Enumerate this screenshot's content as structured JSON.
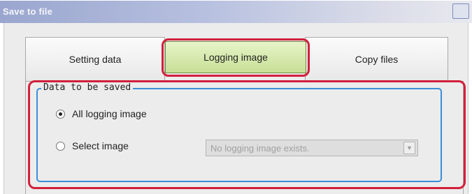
{
  "window": {
    "title": "Save to file"
  },
  "tabs": [
    {
      "label": "Setting data"
    },
    {
      "label": "Logging image"
    },
    {
      "label": "Copy files"
    }
  ],
  "group": {
    "label": "Data to be saved"
  },
  "options": [
    {
      "label": "All logging image",
      "selected": true
    },
    {
      "label": "Select image",
      "selected": false
    }
  ],
  "image_select": {
    "value": "No logging image exists.",
    "enabled": false
  },
  "colors": {
    "highlight": "#d21f3c",
    "groupbox_border": "#3b8fd9",
    "active_tab": "#c7df95"
  }
}
